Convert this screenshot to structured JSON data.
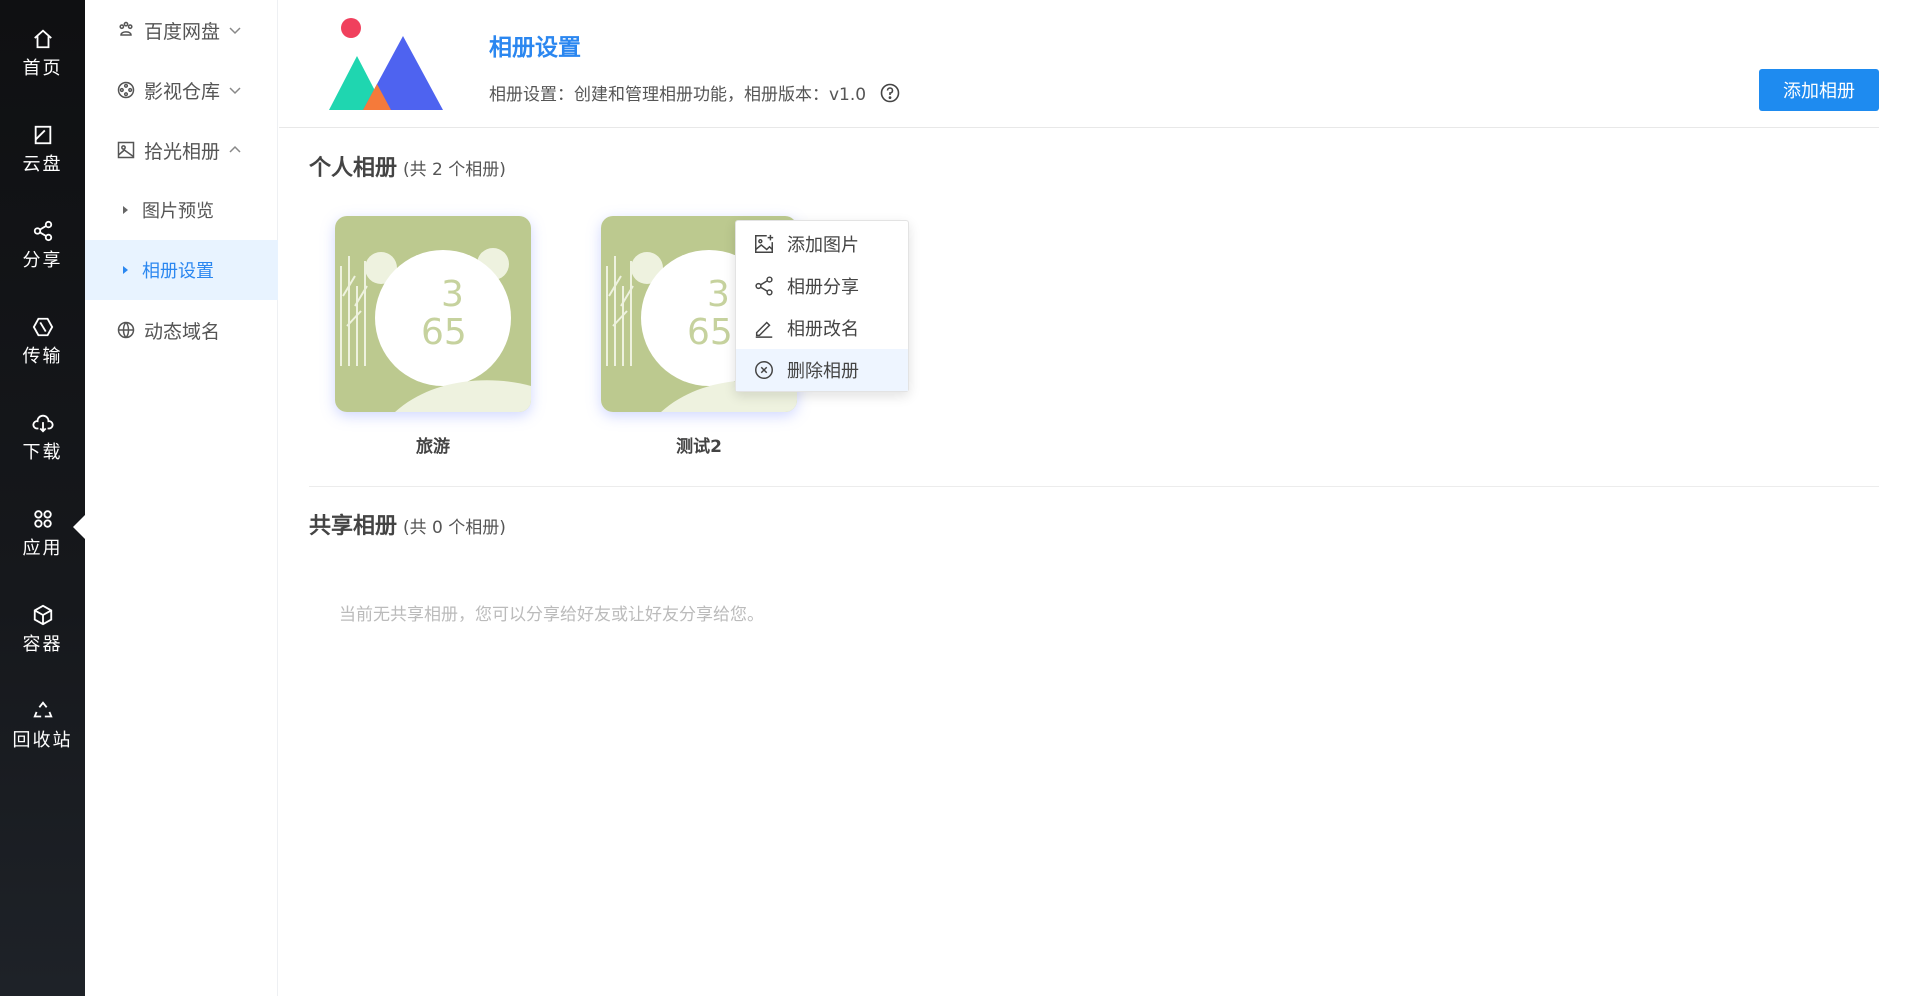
{
  "leftnav": {
    "items": [
      {
        "label": "首页",
        "icon": "home-icon"
      },
      {
        "label": "云盘",
        "icon": "cloud-disk-icon"
      },
      {
        "label": "分享",
        "icon": "share-icon"
      },
      {
        "label": "传输",
        "icon": "transfer-icon"
      },
      {
        "label": "下载",
        "icon": "download-icon"
      },
      {
        "label": "应用",
        "icon": "apps-icon"
      },
      {
        "label": "容器",
        "icon": "container-icon"
      },
      {
        "label": "回收站",
        "icon": "recycle-icon"
      }
    ]
  },
  "submenu": {
    "items": [
      {
        "label": "百度网盘"
      },
      {
        "label": "影视仓库"
      },
      {
        "label": "拾光相册"
      },
      {
        "label": "图片预览"
      },
      {
        "label": "相册设置"
      },
      {
        "label": "动态域名"
      }
    ]
  },
  "header": {
    "title": "相册设置",
    "subtitle": "相册设置：创建和管理相册功能，相册版本：v1.0",
    "add_button": "添加相册"
  },
  "personal": {
    "title": "个人相册",
    "count": "(共 2 个相册)",
    "albums": [
      {
        "name": "旅游"
      },
      {
        "name": "测试2"
      }
    ]
  },
  "context_menu": {
    "items": [
      {
        "label": "添加图片"
      },
      {
        "label": "相册分享"
      },
      {
        "label": "相册改名"
      },
      {
        "label": "删除相册"
      }
    ]
  },
  "shared": {
    "title": "共享相册",
    "count": "(共 0 个相册)",
    "empty_text": "当前无共享相册，您可以分享给好友或让好友分享给您。"
  },
  "colors": {
    "accent": "#1e8bf0",
    "active_bg": "#e8f3ff",
    "album_bg": "#bcc98f"
  }
}
